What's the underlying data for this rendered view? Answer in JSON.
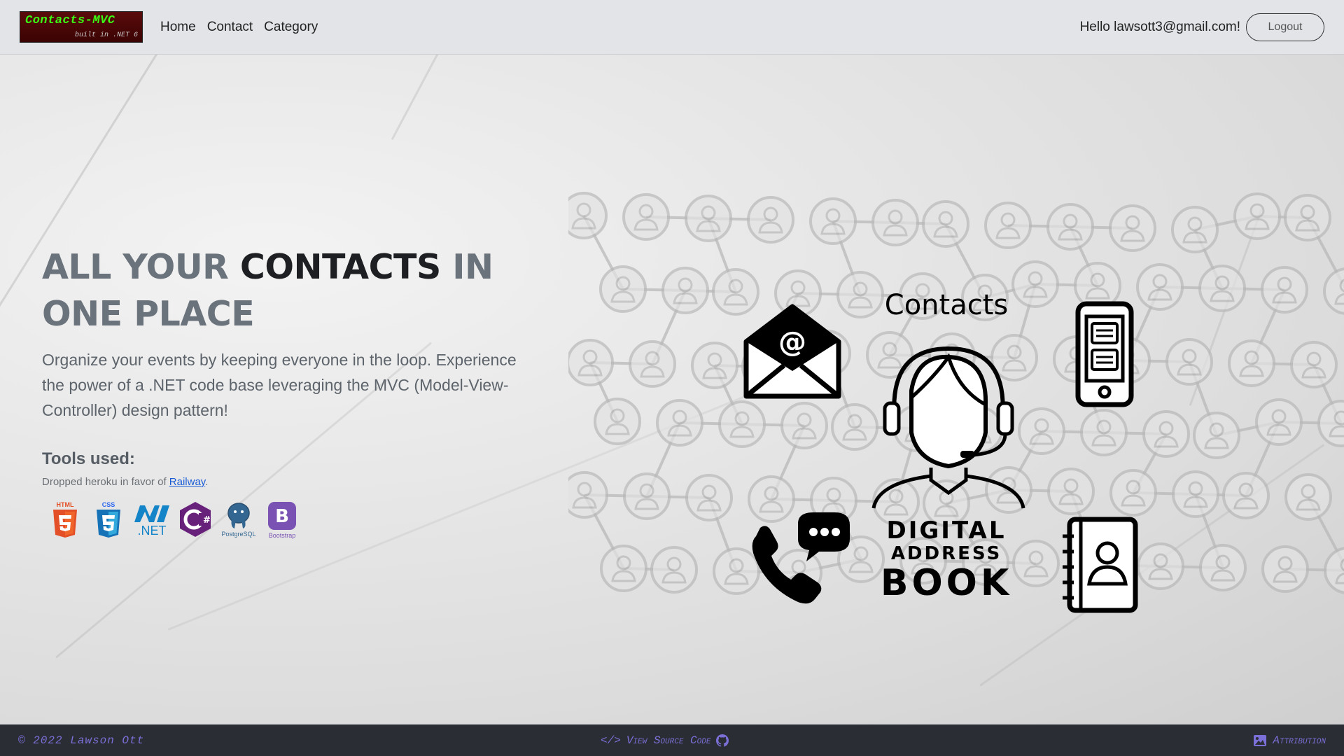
{
  "navbar": {
    "brand_title": "Contacts-MVC",
    "brand_subtitle": "built in .NET 6",
    "links": [
      "Home",
      "Contact",
      "Category"
    ],
    "greeting": "Hello lawsott3@gmail.com!",
    "logout_label": "Logout"
  },
  "hero": {
    "headline_part1": "ALL YOUR ",
    "headline_part2": "CONTACTS",
    "headline_part3": " IN ONE PLACE",
    "lead": "Organize your events by keeping everyone in the loop. Experience the power of a .NET code base leveraging the MVC (Model-View-Controller) design pattern!",
    "tools_title": "Tools used:",
    "tools_note_prefix": "Dropped heroku in favor of ",
    "tools_note_link": "Railway",
    "tools_note_suffix": ".",
    "tools": [
      {
        "name": "HTML5",
        "caption": "HTML",
        "icon": "html5-icon",
        "color": "#e34f26"
      },
      {
        "name": "CSS3",
        "caption": "CSS",
        "icon": "css3-icon",
        "color": "#2965f1"
      },
      {
        "name": ".NET",
        "caption": "Microsoft .NET",
        "icon": "dotnet-icon",
        "color": "#1384c8"
      },
      {
        "name": "C#",
        "caption": "",
        "icon": "csharp-icon",
        "color": "#68217a"
      },
      {
        "name": "PostgreSQL",
        "caption": "PostgreSQL",
        "icon": "postgresql-icon",
        "color": "#336791"
      },
      {
        "name": "Bootstrap",
        "caption": "Bootstrap",
        "icon": "bootstrap-icon",
        "color": "#7952b3"
      }
    ]
  },
  "illustration": {
    "contacts_label": "Contacts",
    "digital_label": "DIGITAL",
    "address_label": "ADDRESS",
    "book_label": "BOOK"
  },
  "footer": {
    "copyright": "© 2022 Lawson Ott",
    "source_label": "View Source Code",
    "attribution_label": "Attribution"
  }
}
